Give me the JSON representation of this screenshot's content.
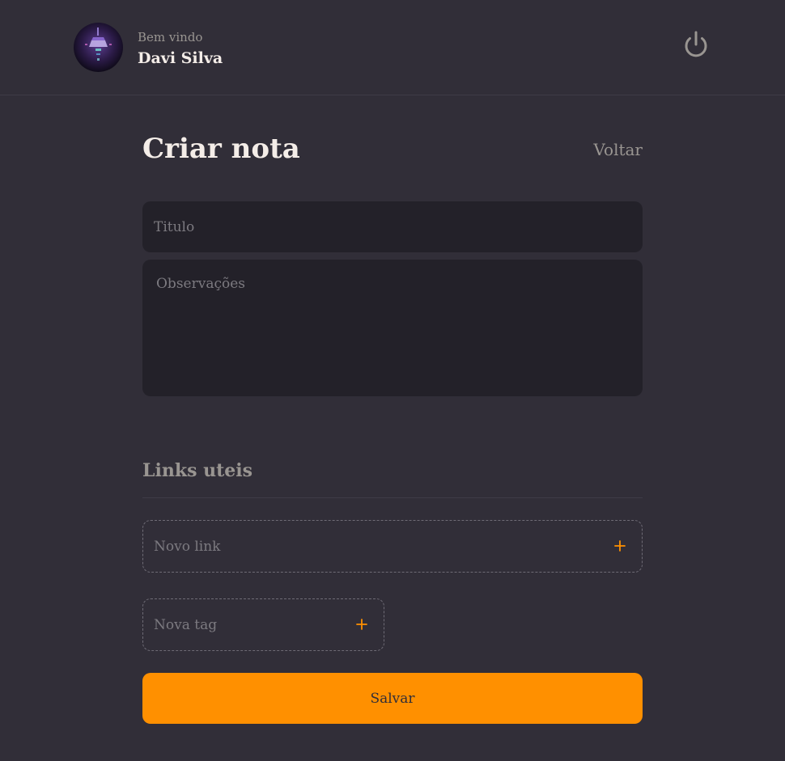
{
  "header": {
    "welcome": "Bem vindo",
    "user_name": "Davi Silva",
    "avatar_icon": "user-avatar",
    "logout_icon": "power-icon"
  },
  "page": {
    "title": "Criar nota",
    "back_label": "Voltar"
  },
  "form": {
    "title_placeholder": "Titulo",
    "title_value": "",
    "observations_placeholder": "Observações",
    "observations_value": ""
  },
  "links": {
    "section_title": "Links uteis",
    "new_link_placeholder": "Novo link",
    "add_icon": "plus-icon"
  },
  "tags": {
    "new_tag_placeholder": "Nova tag",
    "add_icon": "plus-icon"
  },
  "actions": {
    "save_label": "Salvar"
  },
  "colors": {
    "background": "#312E38",
    "input_background": "#232129",
    "accent": "#FF9000",
    "muted_text": "#999591",
    "primary_text": "#F4EDE8"
  }
}
